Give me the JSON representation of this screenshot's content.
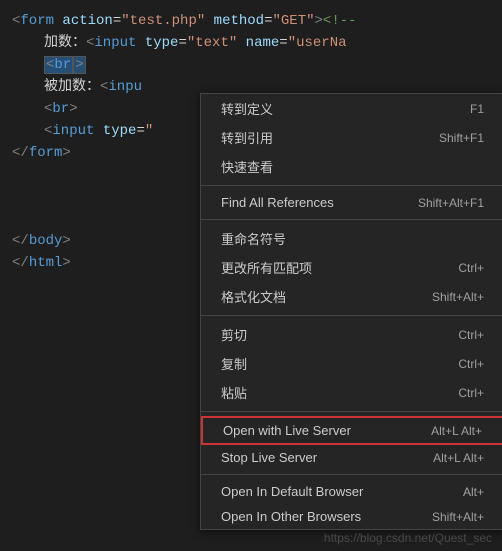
{
  "code": {
    "l1_open": "<",
    "l1_tag": "form",
    "l1_sp": " ",
    "l1_attr1": "action",
    "l1_eq": "=",
    "l1_val1": "\"test.php\"",
    "l1_attr2": "method",
    "l1_val2": "\"GET\"",
    "l1_close": ">",
    "l1_cmt": "<!--",
    "l2_text": "加数：",
    "l2_open": "<",
    "l2_tag": "input",
    "l2_attr1": "type",
    "l2_val1": "\"text\"",
    "l2_attr2": "name",
    "l2_val2": "\"userNa",
    "l3_open": "<",
    "l3_tag": "br",
    "l3_close": ">",
    "l4_text": "被加数：",
    "l4_open": "<",
    "l4_tag": "inpu",
    "l5_open": "<",
    "l5_tag": "br",
    "l5_close": ">",
    "l6_open": "<",
    "l6_tag": "input",
    "l6_attr1": "type",
    "l6_val1": "\"",
    "l7_open": "</",
    "l7_tag": "form",
    "l7_close": ">",
    "l8_open": "</",
    "l8_tag": "body",
    "l8_close": ">",
    "l9_open": "</",
    "l9_tag": "html",
    "l9_close": ">"
  },
  "menu": {
    "items": [
      {
        "label": "转到定义",
        "shortcut": "F1"
      },
      {
        "label": "转到引用",
        "shortcut": "Shift+F1"
      },
      {
        "label": "快速查看",
        "shortcut": ""
      }
    ],
    "items2": [
      {
        "label": "Find All References",
        "shortcut": "Shift+Alt+F1"
      }
    ],
    "items3": [
      {
        "label": "重命名符号",
        "shortcut": ""
      },
      {
        "label": "更改所有匹配项",
        "shortcut": "Ctrl+"
      },
      {
        "label": "格式化文档",
        "shortcut": "Shift+Alt+"
      }
    ],
    "items4": [
      {
        "label": "剪切",
        "shortcut": "Ctrl+"
      },
      {
        "label": "复制",
        "shortcut": "Ctrl+"
      },
      {
        "label": "粘贴",
        "shortcut": "Ctrl+"
      }
    ],
    "items5": [
      {
        "label": "Open with Live Server",
        "shortcut": "Alt+L Alt+"
      },
      {
        "label": "Stop Live Server",
        "shortcut": "Alt+L Alt+"
      }
    ],
    "items6": [
      {
        "label": "Open In Default Browser",
        "shortcut": "Alt+"
      },
      {
        "label": "Open In Other Browsers",
        "shortcut": "Shift+Alt+"
      }
    ]
  },
  "watermark": "https://blog.csdn.net/Quest_sec"
}
